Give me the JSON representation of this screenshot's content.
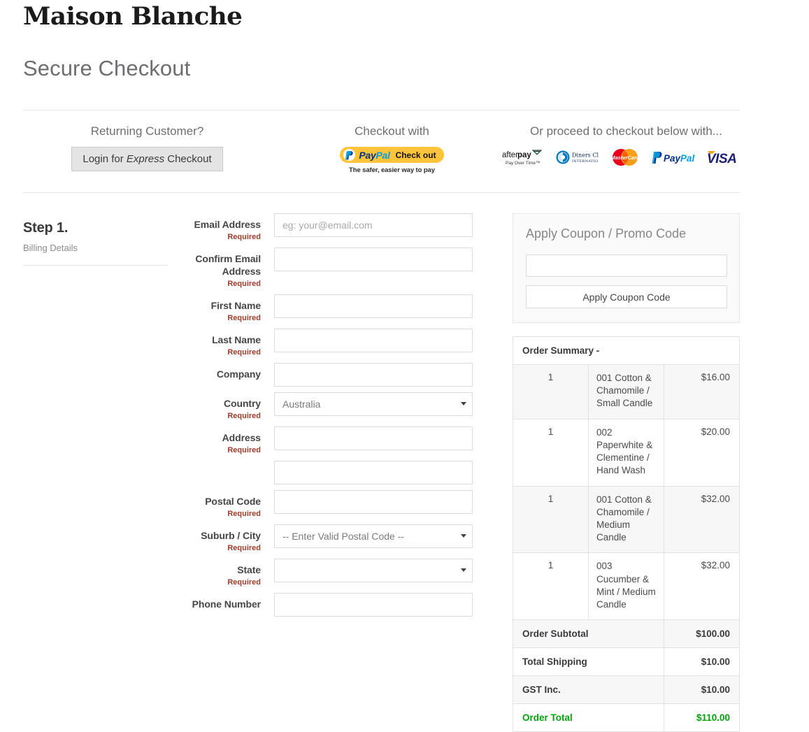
{
  "brand": {
    "name": "Maison Blanche"
  },
  "header": {
    "title": "Secure Checkout"
  },
  "express": {
    "returning": {
      "heading": "Returning Customer?",
      "button_prefix": "Login for ",
      "button_emphasis": "Express",
      "button_suffix": " Checkout"
    },
    "paypal": {
      "heading": "Checkout with",
      "wordmark_pay": "Pay",
      "wordmark_pal": "Pal",
      "cta": "Check out",
      "tagline": "The safer, easier way to pay"
    },
    "cards": {
      "heading": "Or proceed to checkout below with...",
      "logos": [
        {
          "name": "afterpay-logo",
          "label": "afterpay",
          "sub": "Pay Over Time™"
        },
        {
          "name": "diners-club-logo",
          "label": "Diners Club",
          "sub": "INTERNATIONAL"
        },
        {
          "name": "mastercard-logo",
          "label": "MasterCard"
        },
        {
          "name": "paypal-logo",
          "label": "PayPal"
        },
        {
          "name": "visa-logo",
          "label": "VISA"
        }
      ]
    }
  },
  "step": {
    "title": "Step 1.",
    "subtitle": "Billing Details"
  },
  "form": {
    "required_text": "Required",
    "fields": [
      {
        "name": "email-address",
        "label": "Email Address",
        "required": "Required",
        "type": "input",
        "placeholder": "eg: your@email.com",
        "value": ""
      },
      {
        "name": "confirm-email",
        "label": "Confirm Email Address",
        "required": "Required",
        "type": "input",
        "placeholder": "",
        "value": ""
      },
      {
        "name": "first-name",
        "label": "First Name",
        "required": "Required",
        "type": "input",
        "placeholder": "",
        "value": ""
      },
      {
        "name": "last-name",
        "label": "Last Name",
        "required": "Required",
        "type": "input",
        "placeholder": "",
        "value": ""
      },
      {
        "name": "company",
        "label": "Company",
        "required": "",
        "type": "input",
        "placeholder": "",
        "value": ""
      },
      {
        "name": "country",
        "label": "Country",
        "required": "Required",
        "type": "select",
        "value": "Australia"
      },
      {
        "name": "address-line-1",
        "label": "Address",
        "required": "Required",
        "type": "input",
        "placeholder": "",
        "value": ""
      },
      {
        "name": "address-line-2",
        "label": "",
        "required": "",
        "type": "input",
        "placeholder": "",
        "value": ""
      },
      {
        "name": "postal-code",
        "label": "Postal Code",
        "required": "Required",
        "type": "input",
        "placeholder": "",
        "value": ""
      },
      {
        "name": "suburb-city",
        "label": "Suburb / City",
        "required": "Required",
        "type": "select",
        "value": "-- Enter Valid Postal Code --"
      },
      {
        "name": "state",
        "label": "State",
        "required": "Required",
        "type": "select",
        "value": ""
      },
      {
        "name": "phone-number",
        "label": "Phone Number",
        "required": "",
        "type": "input",
        "placeholder": "",
        "value": ""
      }
    ]
  },
  "coupon": {
    "title": "Apply Coupon / Promo Code",
    "input_value": "",
    "button_label": "Apply Coupon Code"
  },
  "order_summary": {
    "heading": "Order Summary -",
    "items": [
      {
        "qty": "1",
        "description": "001 Cotton & Chamomile / Small Candle",
        "price": "$16.00"
      },
      {
        "qty": "1",
        "description": "002 Paperwhite & Clementine / Hand Wash",
        "price": "$20.00"
      },
      {
        "qty": "1",
        "description": "001 Cotton & Chamomile / Medium Candle",
        "price": "$32.00"
      },
      {
        "qty": "1",
        "description": "003 Cucumber & Mint / Medium Candle",
        "price": "$32.00"
      }
    ],
    "totals": [
      {
        "label": "Order Subtotal",
        "value": "$100.00"
      },
      {
        "label": "Total Shipping",
        "value": "$10.00"
      },
      {
        "label": "GST Inc.",
        "value": "$10.00"
      },
      {
        "label": "Order Total",
        "value": "$110.00"
      }
    ]
  },
  "colors": {
    "total_green": "#03a10b",
    "required_red": "#a03b2a",
    "paypal_yellow": "#ffc439",
    "paypal_blue": "#003087",
    "paypal_light_blue": "#009cde",
    "visa_blue": "#1a1f71",
    "mastercard_red": "#eb001b",
    "mastercard_orange": "#f79e1b",
    "afterpay_mint": "#b2fce4",
    "text_dark": "#3a3a3e",
    "text_muted": "#6e6e72"
  }
}
